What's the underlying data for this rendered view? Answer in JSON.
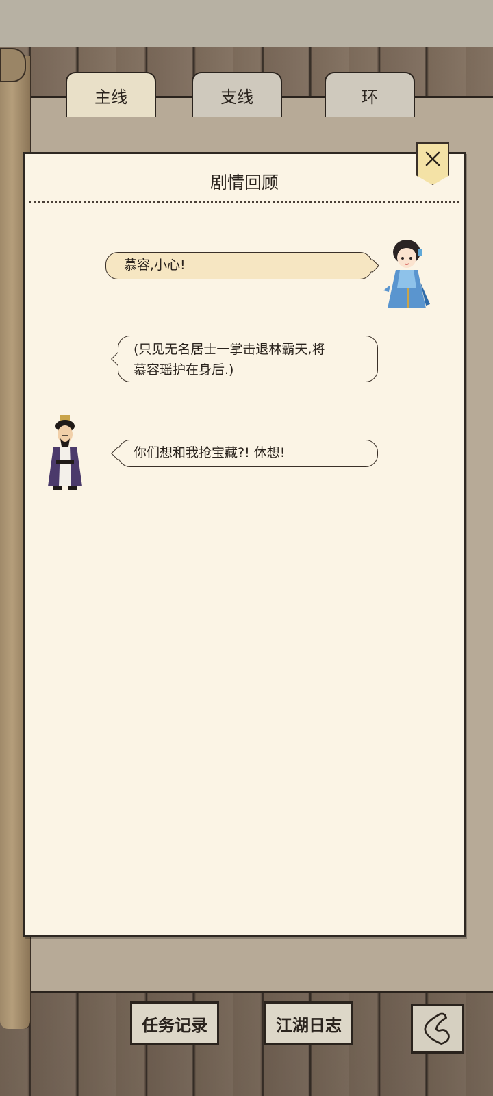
{
  "tabs": [
    {
      "label": "主线",
      "active": true
    },
    {
      "label": "支线",
      "active": false
    },
    {
      "label": "环",
      "active": false
    }
  ],
  "panel": {
    "title": "剧情回顾",
    "close_icon": "close-icon"
  },
  "dialogue": [
    {
      "speaker": "girl",
      "side": "right",
      "text": "慕容,小心!"
    },
    {
      "speaker": "narration",
      "side": "left",
      "lines": [
        "(只见无名居士一掌击退林霸天,将",
        "慕容瑶护在身后.)"
      ]
    },
    {
      "speaker": "man",
      "side": "left",
      "text": "你们想和我抢宝藏?! 休想!"
    }
  ],
  "bottom": {
    "task_label": "任务记录",
    "journal_label": "江湖日志",
    "back_icon": "back-icon"
  },
  "colors": {
    "paper": "#fbf4e5",
    "bubble_highlight": "#f6e6c2",
    "ink": "#2a231d",
    "close_tag": "#f4e2a6"
  }
}
